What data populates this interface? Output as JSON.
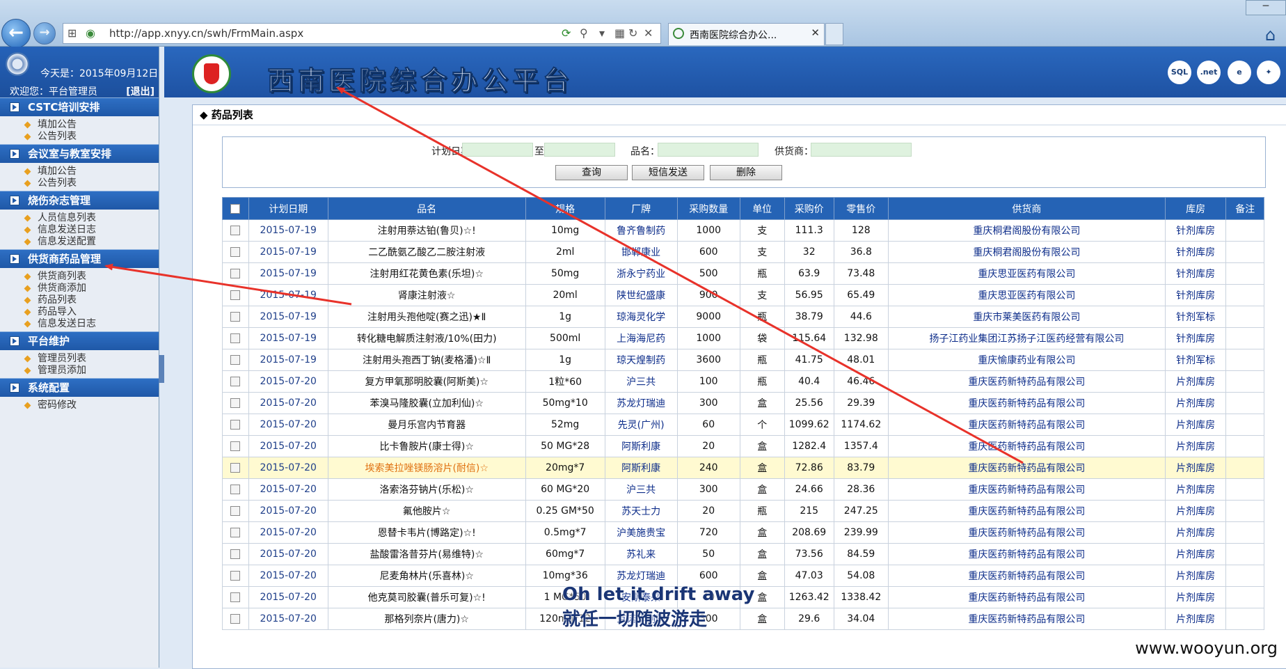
{
  "browser": {
    "url": "http://app.xnyy.cn/swh/FrmMain.aspx",
    "tab_title": "西南医院综合办公..."
  },
  "sidebar": {
    "today": "今天是：2015年09月12日",
    "welcome": "欢迎您：平台管理员",
    "logout": "[退出]",
    "sections": [
      {
        "title": "CSTC培训安排",
        "items": [
          "填加公告",
          "公告列表"
        ]
      },
      {
        "title": "会议室与教室安排",
        "items": [
          "填加公告",
          "公告列表"
        ]
      },
      {
        "title": "烧伤杂志管理",
        "items": [
          "人员信息列表",
          "信息发送日志",
          "信息发送配置"
        ]
      },
      {
        "title": "供货商药品管理",
        "items": [
          "供货商列表",
          "供货商添加",
          "药品列表",
          "药品导入",
          "信息发送日志"
        ]
      },
      {
        "title": "平台维护",
        "items": [
          "管理员列表",
          "管理员添加"
        ]
      },
      {
        "title": "系统配置",
        "items": [
          "密码修改"
        ]
      }
    ]
  },
  "header": {
    "title": "西南医院综合办公平台",
    "icons": [
      "sql-server-icon",
      "dotnet-icon",
      "ie-icon",
      "accessibility-icon"
    ],
    "icon_labels": [
      "SQL",
      ".net",
      "e",
      "✦"
    ]
  },
  "panel": {
    "title": "药品列表",
    "filter": {
      "plan_date_label": "计划日期：",
      "to_label": "至",
      "name_label": "品名：",
      "supplier_label": "供货商：",
      "query_button": "查询",
      "sms_button": "短信发送",
      "delete_button": "删除"
    }
  },
  "table": {
    "headers": [
      "计划日期",
      "品名",
      "规格",
      "厂牌",
      "采购数量",
      "单位",
      "采购价",
      "零售价",
      "供货商",
      "库房",
      "备注"
    ],
    "rows": [
      [
        "2015-07-19",
        "注射用萘达铂(鲁贝)☆!",
        "10mg",
        "鲁齐鲁制药",
        "1000",
        "支",
        "111.3",
        "128",
        "重庆桐君阁股份有限公司",
        "针剂库房",
        ""
      ],
      [
        "2015-07-19",
        "二乙酰氨乙酸乙二胺注射液",
        "2ml",
        "邯郸康业",
        "600",
        "支",
        "32",
        "36.8",
        "重庆桐君阁股份有限公司",
        "针剂库房",
        ""
      ],
      [
        "2015-07-19",
        "注射用红花黄色素(乐坦)☆",
        "50mg",
        "浙永宁药业",
        "500",
        "瓶",
        "63.9",
        "73.48",
        "重庆思亚医药有限公司",
        "针剂库房",
        ""
      ],
      [
        "2015-07-19",
        "肾康注射液☆",
        "20ml",
        "陕世纪盛康",
        "900",
        "支",
        "56.95",
        "65.49",
        "重庆思亚医药有限公司",
        "针剂库房",
        ""
      ],
      [
        "2015-07-19",
        "注射用头孢他啶(赛之迅)★Ⅱ",
        "1g",
        "琼海灵化学",
        "9000",
        "瓶",
        "38.79",
        "44.6",
        "重庆市莱美医药有限公司",
        "针剂军标",
        ""
      ],
      [
        "2015-07-19",
        "转化糖电解质注射液/10%(田力)",
        "500ml",
        "上海海尼药",
        "1000",
        "袋",
        "115.64",
        "132.98",
        "扬子江药业集团江苏扬子江医药经营有限公司",
        "针剂库房",
        ""
      ],
      [
        "2015-07-19",
        "注射用头孢西丁钠(麦格潘)☆Ⅱ",
        "1g",
        "琼天煌制药",
        "3600",
        "瓶",
        "41.75",
        "48.01",
        "重庆愉康药业有限公司",
        "针剂军标",
        ""
      ],
      [
        "2015-07-20",
        "复方甲氧那明胶囊(阿斯美)☆",
        "1粒*60",
        "沪三共",
        "100",
        "瓶",
        "40.4",
        "46.46",
        "重庆医药新特药品有限公司",
        "片剂库房",
        ""
      ],
      [
        "2015-07-20",
        "苯溴马隆胶囊(立加利仙)☆",
        "50mg*10",
        "苏龙灯瑞迪",
        "300",
        "盒",
        "25.56",
        "29.39",
        "重庆医药新特药品有限公司",
        "片剂库房",
        ""
      ],
      [
        "2015-07-20",
        "曼月乐宫内节育器",
        "52mg",
        "先灵(广州)",
        "60",
        "个",
        "1099.62",
        "1174.62",
        "重庆医药新特药品有限公司",
        "片剂库房",
        ""
      ],
      [
        "2015-07-20",
        "比卡鲁胺片(康士得)☆",
        "50 MG*28",
        "阿斯利康",
        "20",
        "盒",
        "1282.4",
        "1357.4",
        "重庆医药新特药品有限公司",
        "片剂库房",
        ""
      ],
      [
        "2015-07-20",
        "埃索美拉唑镁肠溶片(耐信)☆",
        "20mg*7",
        "阿斯利康",
        "240",
        "盒",
        "72.86",
        "83.79",
        "重庆医药新特药品有限公司",
        "片剂库房",
        ""
      ],
      [
        "2015-07-20",
        "洛索洛芬钠片(乐松)☆",
        "60 MG*20",
        "沪三共",
        "300",
        "盒",
        "24.66",
        "28.36",
        "重庆医药新特药品有限公司",
        "片剂库房",
        ""
      ],
      [
        "2015-07-20",
        "氟他胺片☆",
        "0.25 GM*50",
        "苏天士力",
        "20",
        "瓶",
        "215",
        "247.25",
        "重庆医药新特药品有限公司",
        "片剂库房",
        ""
      ],
      [
        "2015-07-20",
        "恩替卡韦片(博路定)☆!",
        "0.5mg*7",
        "沪美施贵宝",
        "720",
        "盒",
        "208.69",
        "239.99",
        "重庆医药新特药品有限公司",
        "片剂库房",
        ""
      ],
      [
        "2015-07-20",
        "盐酸雷洛昔芬片(易维特)☆",
        "60mg*7",
        "苏礼来",
        "50",
        "盒",
        "73.56",
        "84.59",
        "重庆医药新特药品有限公司",
        "片剂库房",
        ""
      ],
      [
        "2015-07-20",
        "尼麦角林片(乐喜林)☆",
        "10mg*36",
        "苏龙灯瑞迪",
        "600",
        "盒",
        "47.03",
        "54.08",
        "重庆医药新特药品有限公司",
        "片剂库房",
        ""
      ],
      [
        "2015-07-20",
        "他克莫司胶囊(普乐可复)☆!",
        "1 MG*50",
        "安斯泰来",
        "40",
        "盒",
        "1263.42",
        "1338.42",
        "重庆医药新特药品有限公司",
        "片剂库房",
        ""
      ],
      [
        "2015-07-20",
        "那格列奈片(唐力)☆",
        "120mg*12",
        "京诺华制药",
        "300",
        "盒",
        "29.6",
        "34.04",
        "重庆医药新特药品有限公司",
        "片剂库房",
        ""
      ]
    ],
    "highlighted_row": 11
  },
  "overlay": {
    "lyric_line1": "Oh let it drift away",
    "lyric_line2": "就任一切随波游走",
    "watermark": "www.wooyun.org"
  },
  "colors": {
    "primary_blue": "#2563b5",
    "highlight_row": "#fffad1",
    "annotation_red": "#e8322a"
  }
}
